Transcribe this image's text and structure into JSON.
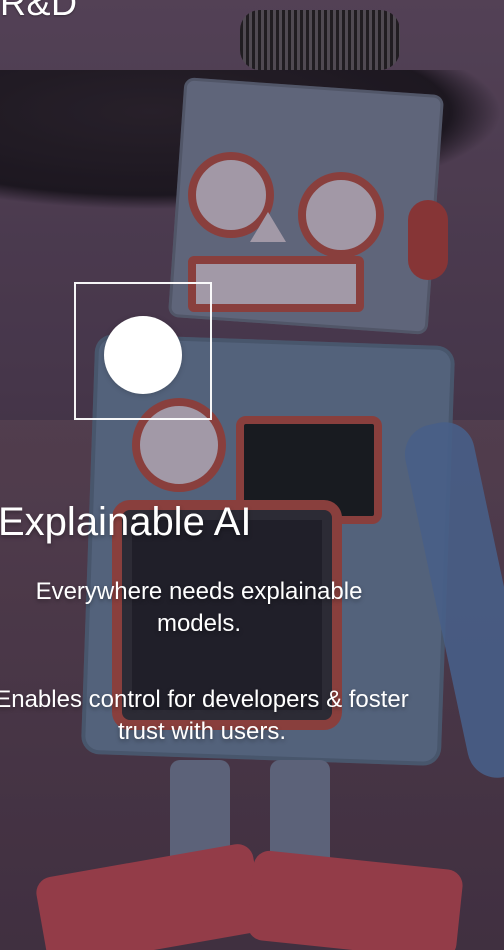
{
  "top_tag": "R&D",
  "hero": {
    "headline": "Explainable AI",
    "paragraph_1": "Everywhere needs explainable models.",
    "paragraph_2": "Enables control for developers & foster trust with users."
  }
}
